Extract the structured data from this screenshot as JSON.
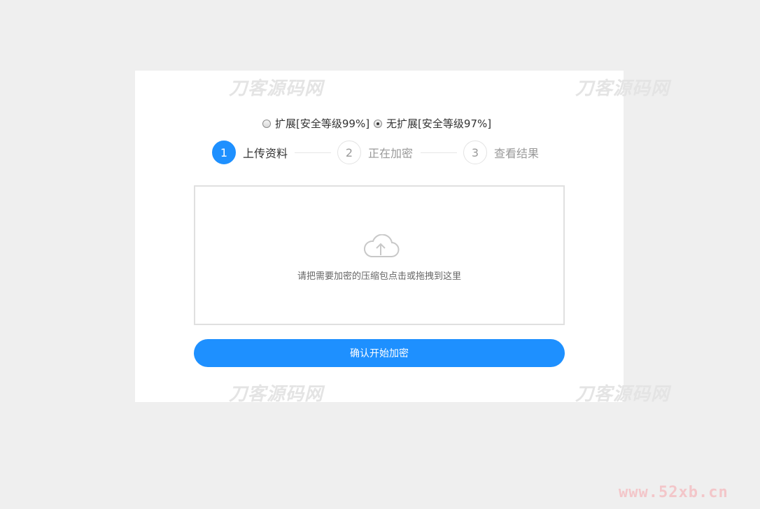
{
  "watermark": {
    "text": "刀客源码网"
  },
  "mode": {
    "options": [
      {
        "label": "扩展[安全等级99%]",
        "checked": false
      },
      {
        "label": "无扩展[安全等级97%]",
        "checked": true
      }
    ]
  },
  "steps": [
    {
      "number": "1",
      "label": "上传资料",
      "active": true
    },
    {
      "number": "2",
      "label": "正在加密",
      "active": false
    },
    {
      "number": "3",
      "label": "查看结果",
      "active": false
    }
  ],
  "upload": {
    "hint": "请把需要加密的压缩包点击或拖拽到这里",
    "icon": "cloud-upload-icon"
  },
  "confirm": {
    "label": "确认开始加密"
  },
  "site": {
    "text": "www.52xb.cn"
  },
  "colors": {
    "accent": "#1e90ff",
    "background": "#efefef"
  }
}
